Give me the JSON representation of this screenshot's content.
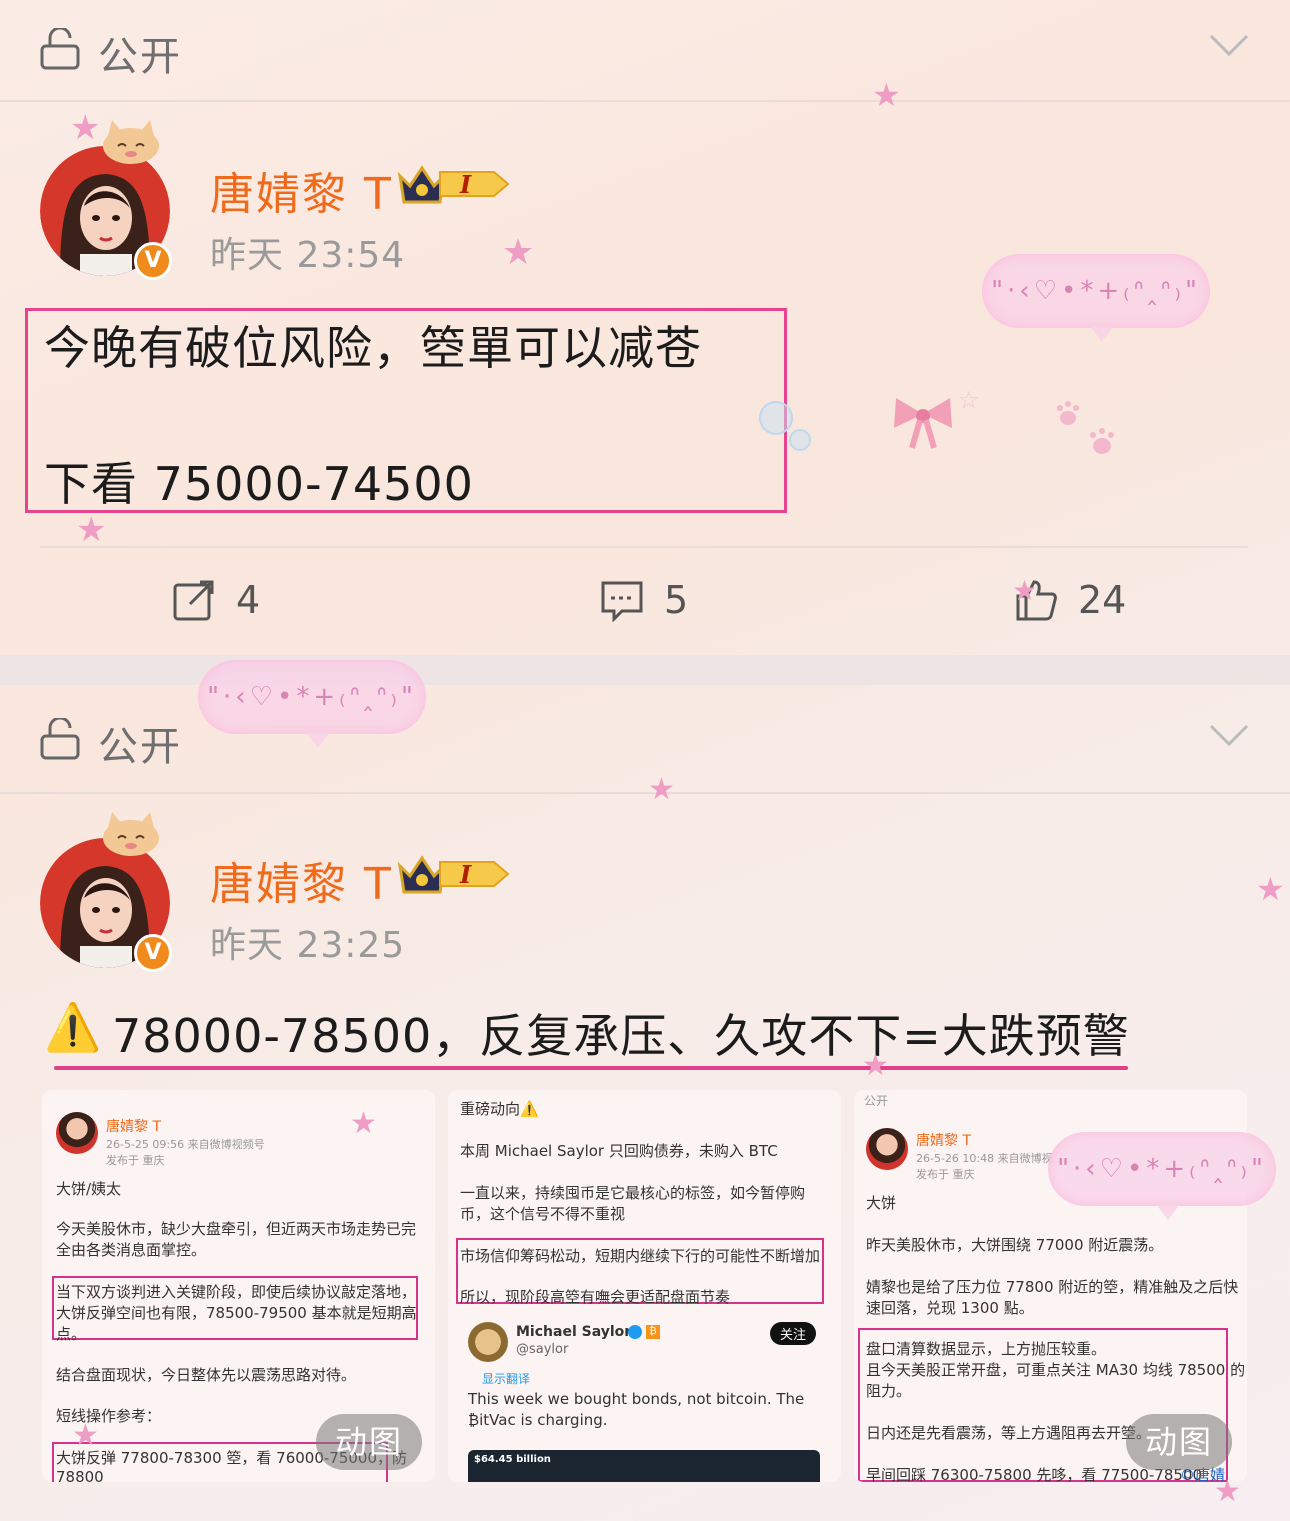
{
  "posts": [
    {
      "visibility": "公开",
      "author": "唐婧黎 T",
      "level": "I",
      "time": "昨天 23:54",
      "lines": [
        "今晚有破位风险，箜單可以减苍",
        "下看 75000-74500"
      ],
      "actions": {
        "repost": "4",
        "comment": "5",
        "like": "24"
      }
    },
    {
      "visibility": "公开",
      "author": "唐婧黎 T",
      "level": "I",
      "time": "昨天 23:25",
      "headline_emoji": "⚠️",
      "headline": "78000-78500，反复承压、久攻不下=大跌预警",
      "images": [
        {
          "name": "唐婧黎 T",
          "meta1": "26-5-25 09:56  来自微博视频号",
          "meta2": "发布于 重庆",
          "lines": [
            "大饼/姨太",
            "今天美股休市，缺少大盘牵引，但近两天市场走势已完",
            "全由各类消息面掌控。",
            "当下双方谈判进入关键阶段，即使后续协议敲定落地，",
            "大饼反弹空间也有限，78500-79500 基本就是短期高",
            "点。",
            "结合盘面现状，今日整体先以震荡思路对待。",
            "短线操作参考：",
            "大饼反弹 77800-78300 箜，看 76000-75000，防",
            "78800"
          ],
          "badge": "动图"
        },
        {
          "title": "重磅动向⚠️",
          "lines": [
            "本周 Michael Saylor 只回购债券，未购入 BTC",
            "一直以来，持续囤币是它最核心的标签，如今暂停购",
            "币，这个信号不得不重视",
            "市场信仰筹码松动，短期内继续下行的可能性不断增加",
            "所以，现阶段高箜有嘸会更适配盘面节奏"
          ],
          "tweet_name": "Michael Saylor",
          "tweet_handle": "@saylor",
          "follow": "关注",
          "translate": "显示翻译",
          "tweet_text_1": "This week we bought bonds, not bitcoin. The",
          "tweet_text_2": "₿itVac is charging.",
          "tweet_value": "$64.45 billion"
        },
        {
          "visibility": "公开",
          "name": "唐婧黎 T",
          "meta1": "26-5-26 10:48  来自微博视",
          "meta2": "发布于 重庆",
          "lines": [
            "大饼",
            "昨天美股休市，大饼围绕 77000 附近震荡。",
            "婧黎也是给了压力位 77800 附近的箜，精准触及之后快",
            "速回落，兑现 1300 點。",
            "盘口清算数据显示，上方抛压较重。",
            "且今天美股正常开盘，可重点关注 MA30 均线 78500 的",
            "阻力。",
            "日内还是先看震荡，等上方遇阻再去开箜。",
            "早间回踩 76300-75800 先哆，看 77500-78500"
          ],
          "tail": "©唐婧",
          "badge": "动图"
        }
      ]
    }
  ],
  "decorations": {
    "bubble_text": "\"·‹♡•*+₍ᐢ‸ᐢ₎\"",
    "colors": {
      "accent_pink": "#e6448e",
      "name_orange": "#f06a1c",
      "time_gray": "#9a9a9a"
    }
  }
}
